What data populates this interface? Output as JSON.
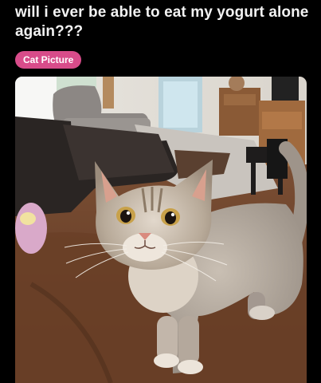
{
  "post": {
    "title": "will i ever be able to eat my yogurt alone again???",
    "flair": "Cat Picture"
  },
  "image": {
    "alt": "Cat Picture"
  },
  "colors": {
    "background": "#000000",
    "title_text": "#f2f2f2",
    "flair_background": "#d84c8a",
    "flair_text": "#ffffff"
  }
}
